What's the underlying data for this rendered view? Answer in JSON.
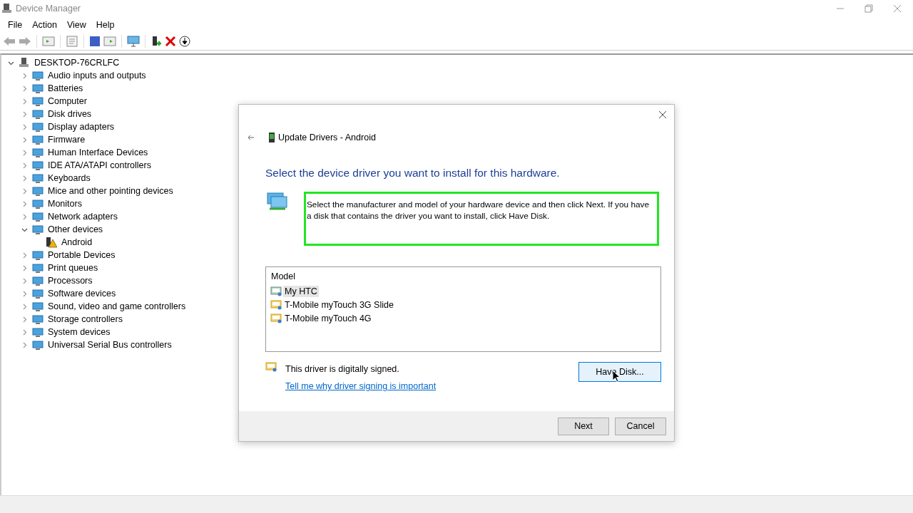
{
  "window": {
    "title": "Device Manager"
  },
  "menu": [
    "File",
    "Action",
    "View",
    "Help"
  ],
  "tree": {
    "label": "DESKTOP-76CRLFC",
    "expanded": true,
    "children": [
      {
        "label": "Audio inputs and outputs",
        "expanded": false
      },
      {
        "label": "Batteries",
        "expanded": false
      },
      {
        "label": "Computer",
        "expanded": false
      },
      {
        "label": "Disk drives",
        "expanded": false
      },
      {
        "label": "Display adapters",
        "expanded": false
      },
      {
        "label": "Firmware",
        "expanded": false
      },
      {
        "label": "Human Interface Devices",
        "expanded": false
      },
      {
        "label": "IDE ATA/ATAPI controllers",
        "expanded": false
      },
      {
        "label": "Keyboards",
        "expanded": false
      },
      {
        "label": "Mice and other pointing devices",
        "expanded": false
      },
      {
        "label": "Monitors",
        "expanded": false
      },
      {
        "label": "Network adapters",
        "expanded": false
      },
      {
        "label": "Other devices",
        "expanded": true,
        "children": [
          {
            "label": "Android",
            "kind": "warning"
          }
        ]
      },
      {
        "label": "Portable Devices",
        "expanded": false
      },
      {
        "label": "Print queues",
        "expanded": false
      },
      {
        "label": "Processors",
        "expanded": false
      },
      {
        "label": "Software devices",
        "expanded": false
      },
      {
        "label": "Sound, video and game controllers",
        "expanded": false
      },
      {
        "label": "Storage controllers",
        "expanded": false
      },
      {
        "label": "System devices",
        "expanded": false
      },
      {
        "label": "Universal Serial Bus controllers",
        "expanded": false
      }
    ]
  },
  "dialog": {
    "title": "Update Drivers - Android",
    "heading": "Select the device driver you want to install for this hardware.",
    "description": "Select the manufacturer and model of your hardware device and then click Next. If you have a disk that contains the driver you want to install, click Have Disk.",
    "model_list": {
      "header": "Model",
      "items": [
        {
          "label": "My HTC",
          "selected": true
        },
        {
          "label": "T-Mobile myTouch 3G Slide",
          "selected": false
        },
        {
          "label": "T-Mobile myTouch 4G",
          "selected": false
        }
      ]
    },
    "signed_text": "This driver is digitally signed.",
    "signing_link": "Tell me why driver signing is important",
    "have_disk": {
      "label": "Have Disk...",
      "hovered": true
    },
    "buttons": [
      "Next",
      "Cancel"
    ]
  }
}
